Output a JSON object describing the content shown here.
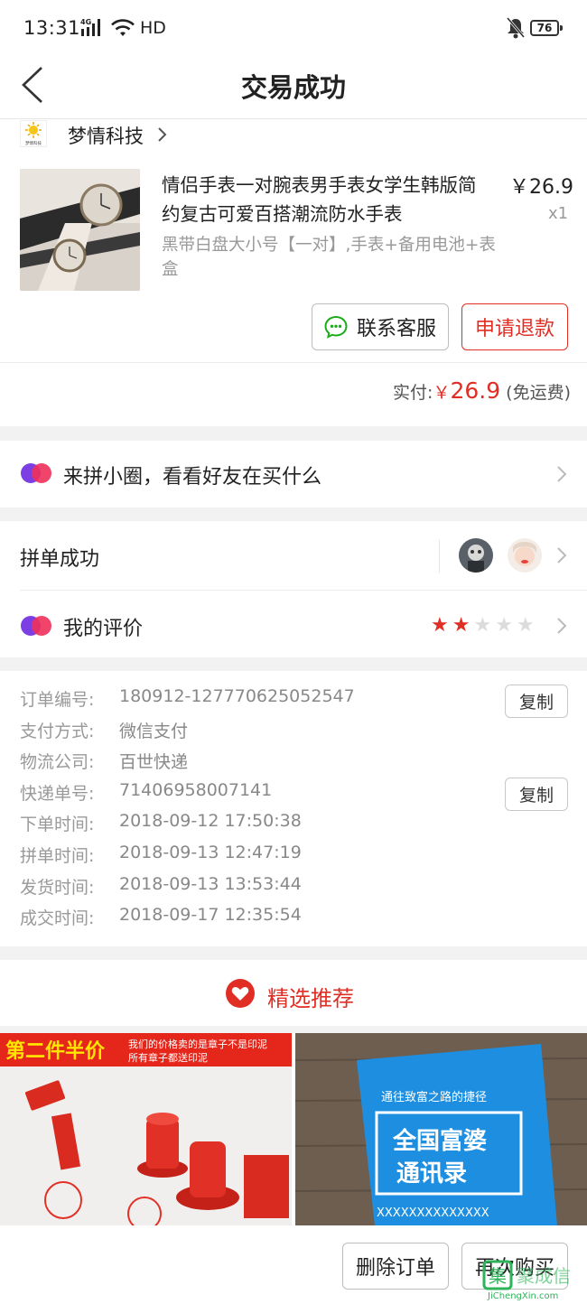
{
  "status": {
    "time": "13:31",
    "network": "4G",
    "hd": "HD",
    "battery": "76"
  },
  "nav": {
    "title": "交易成功"
  },
  "shop": {
    "name": "梦情科技",
    "logo_text": "梦情科技"
  },
  "product": {
    "title": "情侣手表一对腕表男手表女学生韩版简约复古可爱百搭潮流防水手表",
    "price": "￥26.9",
    "qty": "x1",
    "spec": "黑带白盘大小号【一对】,手表+备用电池+表盒"
  },
  "actions": {
    "service": "联系客服",
    "refund": "申请退款"
  },
  "payment": {
    "label": "实付:",
    "yen": "￥",
    "amount": "26.9",
    "shipping": "(免运费)"
  },
  "circle": {
    "label": "来拼小圈，看看好友在买什么"
  },
  "group": {
    "label": "拼单成功"
  },
  "review": {
    "label": "我的评价",
    "rating": 2,
    "max": 5
  },
  "order_info": {
    "rows": [
      {
        "label": "订单编号:",
        "value": "180912-127770625052547"
      },
      {
        "label": "支付方式:",
        "value": "微信支付"
      },
      {
        "label": "物流公司:",
        "value": "百世快递"
      },
      {
        "label": "快递单号:",
        "value": "71406958007141"
      },
      {
        "label": "下单时间:",
        "value": "2018-09-12 17:50:38"
      },
      {
        "label": "拼单时间:",
        "value": "2018-09-13 12:47:19"
      },
      {
        "label": "发货时间:",
        "value": "2018-09-13 13:53:44"
      },
      {
        "label": "成交时间:",
        "value": "2018-09-17 12:35:54"
      }
    ],
    "copy_label": "复制"
  },
  "recommend": {
    "title": "精选推荐",
    "left": {
      "banner": "第二件半价",
      "banner_sub1": "我们的价格卖的是章子不是印泥",
      "banner_sub2": "所有章子都送印泥"
    },
    "right": {
      "book_top": "通往致富之路的捷径",
      "book_line1": "全国富婆",
      "book_line2": "通讯录",
      "book_bottom": "XXXXXXXXXXXXXX"
    }
  },
  "bottom": {
    "delete": "删除订单",
    "rebuy": "再次购买"
  },
  "watermark": {
    "main": "聚成信",
    "url": "JiChengXin.com"
  },
  "colors": {
    "accent": "#e02e24",
    "gray_text": "#999999",
    "background_gap": "#f2f2f2"
  }
}
